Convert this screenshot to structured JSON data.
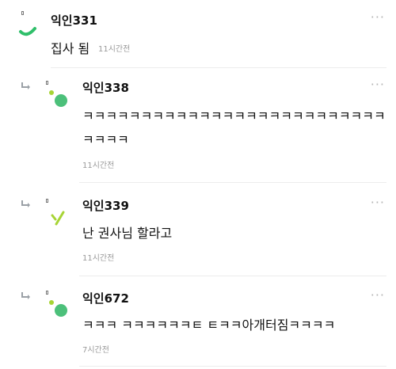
{
  "comments": [
    {
      "author": "익인331",
      "text": "집사 됨",
      "time": "11시간전",
      "is_reply": false,
      "more_icon": "ellipsis-icon"
    },
    {
      "author": "익인338",
      "text_line1": "ㅋㅋㅋㅋㅋㅋㅋㅋㅋㅋㅋㅋㅋㅋㅋㅋㅋㅋㅋㅋㅋㅋㅋㅋㅋㅋ",
      "text_line2": "ㅋㅋㅋㅋ",
      "time": "11시간전",
      "is_reply": true,
      "more_icon": "ellipsis-icon"
    },
    {
      "author": "익인339",
      "text": "난 권사님 할라고",
      "time": "11시간전",
      "is_reply": true,
      "more_icon": "ellipsis-icon"
    },
    {
      "author": "익인672",
      "text": "ㅋㅋㅋ ㅋㅋㅋㅋㅋㅋㅌ ㅌㅋㅋ아개터짐ㅋㅋㅋㅋ",
      "time": "7시간전",
      "is_reply": true,
      "more_icon": "ellipsis-icon"
    }
  ],
  "more_label": "···",
  "colors": {
    "avatar_green": "#4cc07a",
    "avatar_lime": "#a7d435",
    "avatar_arc": "#2fbf6a",
    "reply_arrow": "#9aa0a6",
    "time_gray": "#9a9a9a"
  }
}
